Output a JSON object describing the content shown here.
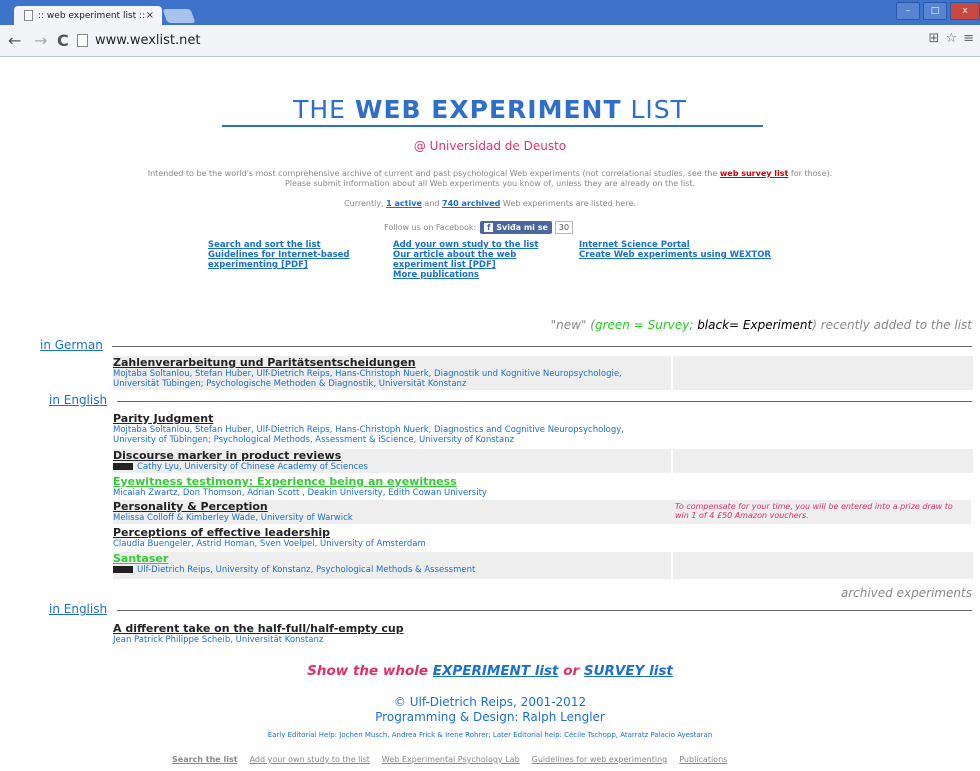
{
  "browser": {
    "tab_title": ":: web experiment list ::",
    "tab_close": "×",
    "url": "www.wexlist.net",
    "window_buttons": [
      "–",
      "□",
      "x"
    ]
  },
  "header": {
    "title_part1": "THE ",
    "title_bold": "WEB EXPERIMENT",
    "title_part2": " LIST",
    "subtitle": "@ Universidad de Deusto",
    "intro_line1_a": "Intended to be the world's most comprehensive archive of current and past psychological Web experiments (not correlational studies, see the ",
    "intro_link": "web survey list",
    "intro_line1_b": " for those).",
    "intro_line2": "Please submit information about all Web experiments you know of, unless they are already on the list.",
    "counts_a": "Currently, ",
    "active_link": "1 active",
    "counts_b": " and ",
    "archived_link": "740 archived",
    "counts_c": " Web experiments are listed here.",
    "facebook_text": "Follow us on Facebook:",
    "fb_button": "Sviđa mi se",
    "fb_count": "30"
  },
  "links": {
    "col1": [
      "Search and sort the list",
      "Guidelines for Internet-based experimenting [PDF]"
    ],
    "col2": [
      "Add your own study to the list",
      "Our article about the web experiment list [PDF]",
      "More publications"
    ],
    "col3": [
      "Internet Science Portal",
      "Create Web experiments using WEXTOR"
    ]
  },
  "legend": {
    "a": "\"new\" (",
    "green": "green = Survey;",
    "black": " black= Experiment",
    "b": ") recently added to the list"
  },
  "sections": {
    "german": "in German",
    "english": "in English",
    "english2": "in English"
  },
  "experiments": [
    {
      "title": "Zahlenverarbeitung und Paritätsentscheidungen",
      "authors": "Mojtaba Soltanlou, Stefan Huber, Ulf-Dietrich Reips, Hans-Christoph Nuerk, Diagnostik und Kognitive Neuropsychologie, Universität Tübingen; Psychologische Methoden & Diagnostik, Universität Konstanz"
    },
    {
      "title": "Parity Judgment",
      "authors": "Mojtaba Soltanlou, Stefan Huber, Ulf-Dietrich Reips, Hans-Christoph Nuerk, Diagnostics and Cognitive Neuropsychology, University of Tübingen; Psychological Methods, Assessment & iScience, University of Konstanz"
    },
    {
      "title": "Discourse marker in product reviews",
      "authors": "Cathy Lyu, University of Chinese Academy of Sciences"
    },
    {
      "title": "Eyewitness testimony: Experience being an eyewitness",
      "authors": "Micaiah Zwartz, Don Thomson, Adrian Scott , Deakin University, Edith Cowan University"
    },
    {
      "title": "Personality & Perception",
      "authors": "Melissa Colloff & Kimberley Wade, University of Warwick",
      "note": "To compensate for your time, you will be entered into a prize draw to win 1 of 4 £50 Amazon vouchers."
    },
    {
      "title": "Perceptions of effective leadership",
      "authors": "Claudia Buengeler, Astrid Homan, Sven Voelpel, University of Amsterdam"
    },
    {
      "title": "Santaser",
      "authors": "Ulf-Dietrich Reips, University of Konstanz, Psychological Methods & Assessment"
    }
  ],
  "archived_label": "archived experiments",
  "archived": {
    "title": "A different take on the half-full/half-empty cup",
    "authors": "Jean Patrick Philippe Scheib, Universität Konstanz"
  },
  "show_whole": {
    "a": "Show the whole ",
    "exp": "EXPERIMENT list",
    "or": " or ",
    "survey": "SURVEY list"
  },
  "footer": {
    "copyright": "© Ulf-Dietrich Reips, 2001-2012",
    "programming": "Programming & Design: Ralph Lengler",
    "editorial": "Early Editorial Help: Jochen Musch, Andrea Frick & Irene Rohrer; Later Editorial help: Cécile Tschopp, Atarratz Palacio Ayestaran",
    "links": [
      "Search the list",
      "Add your own study to the list",
      "Web Experimental Psychology Lab",
      "Guidelines for web experimenting",
      "Publications"
    ]
  },
  "colors": {
    "accent": "#2d6fc9",
    "pink": "#e0306a",
    "survey_green": "#33cc33",
    "link_blue": "#1a6fd4"
  }
}
